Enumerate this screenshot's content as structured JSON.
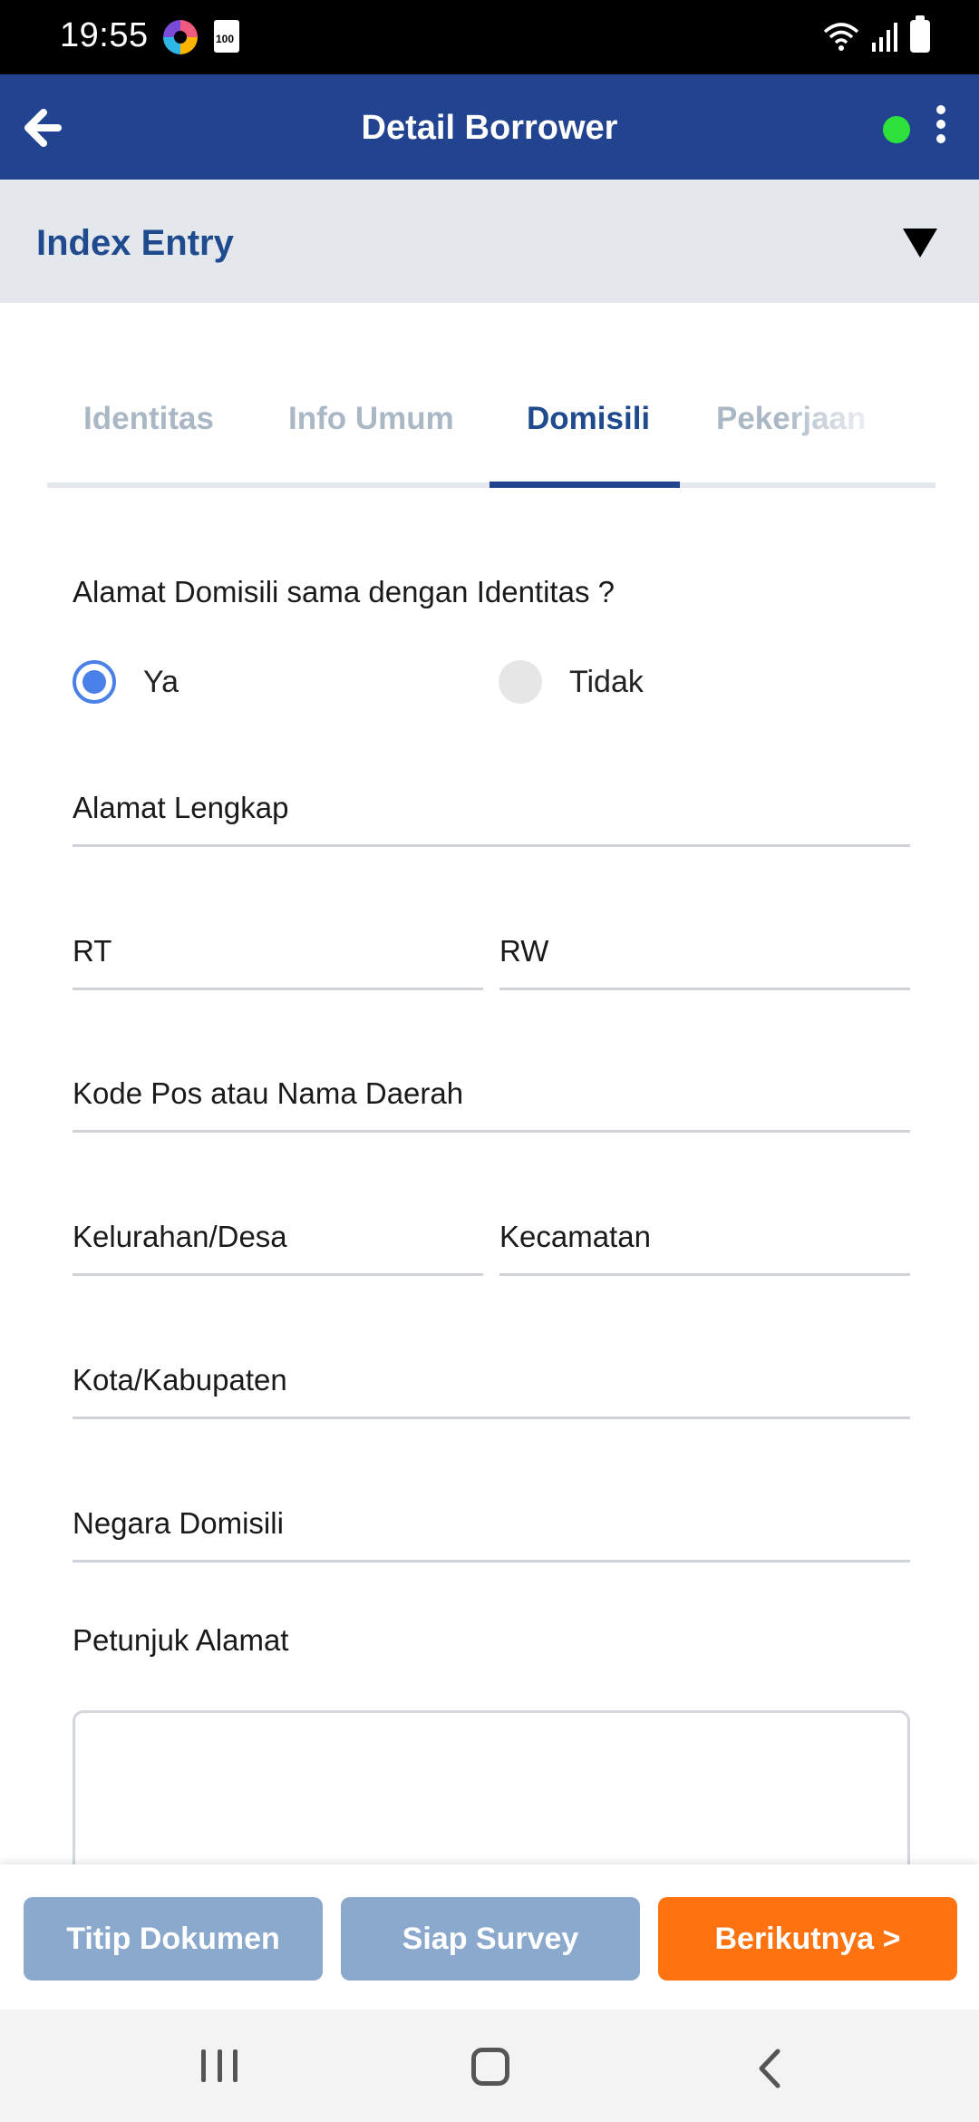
{
  "status_bar": {
    "time": "19:55",
    "sd_label": "100"
  },
  "header": {
    "title": "Detail Borrower",
    "status_color": "#2fe23b"
  },
  "index_entry": {
    "title": "Index Entry"
  },
  "tabs": [
    {
      "label": "Identitas",
      "active": false
    },
    {
      "label": "Info Umum",
      "active": false
    },
    {
      "label": "Domisili",
      "active": true
    },
    {
      "label": "Pekerjaan",
      "active": false
    }
  ],
  "form": {
    "question": "Alamat Domisili sama dengan Identitas ?",
    "options": [
      {
        "label": "Ya",
        "selected": true
      },
      {
        "label": "Tidak",
        "selected": false
      }
    ],
    "fields": {
      "alamat_lengkap": "Alamat Lengkap",
      "rt": "RT",
      "rw": "RW",
      "kode_pos": "Kode Pos atau Nama Daerah",
      "kelurahan": "Kelurahan/Desa",
      "kecamatan": "Kecamatan",
      "kota": "Kota/Kabupaten",
      "negara": "Negara Domisili"
    },
    "petunjuk_label": "Petunjuk Alamat",
    "petunjuk_value": ""
  },
  "actions": {
    "titip_dokumen": "Titip Dokumen",
    "siap_survey": "Siap Survey",
    "berikutnya": "Berikutnya >"
  },
  "colors": {
    "primary": "#22438f",
    "accent": "#ff7210",
    "disabled_button": "#8aa9cd",
    "radio": "#4a81e8"
  }
}
